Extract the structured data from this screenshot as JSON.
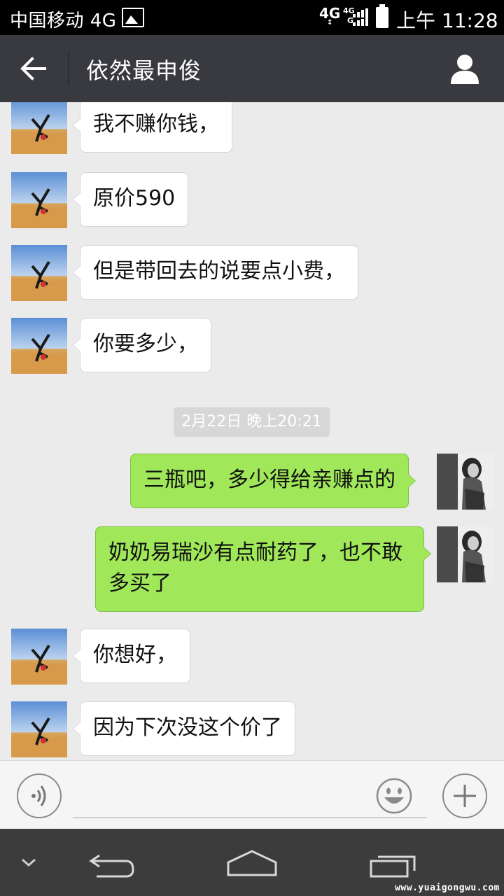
{
  "status_bar": {
    "carrier": "中国移动 4G",
    "network_primary": "4G",
    "network_primary_sub": "↕",
    "network_secondary_top": "4G",
    "network_secondary_bottom": "G",
    "time": "上午 11:28"
  },
  "header": {
    "title": "依然最申俊"
  },
  "messages": [
    {
      "side": "left",
      "text": "我不赚你钱，"
    },
    {
      "side": "left",
      "text": "原价590"
    },
    {
      "side": "left",
      "text": "但是带回去的说要点小费，"
    },
    {
      "side": "left",
      "text": "你要多少，"
    },
    {
      "side": "right",
      "text": "三瓶吧，多少得给亲赚点的"
    },
    {
      "side": "right",
      "text": "奶奶易瑞沙有点耐药了，也不敢多买了"
    },
    {
      "side": "left",
      "text": "你想好，"
    },
    {
      "side": "left",
      "text": "因为下次没这个价了"
    }
  ],
  "timestamp": "2月22日 晚上20:21",
  "input": {
    "placeholder": ""
  },
  "watermark": "www.yuaigongwu.com",
  "colors": {
    "header_bg": "#393a3f",
    "chat_bg": "#ebebeb",
    "sent_bubble": "#a0e759",
    "received_bubble": "#ffffff"
  },
  "icons": {
    "back": "arrow-left-icon",
    "profile": "person-icon",
    "voice": "voice-icon",
    "emoji": "smiley-icon",
    "more": "plus-icon",
    "nav_collapse": "chevron-down-icon",
    "nav_back": "back-icon",
    "nav_home": "home-icon",
    "nav_recent": "recent-apps-icon"
  }
}
